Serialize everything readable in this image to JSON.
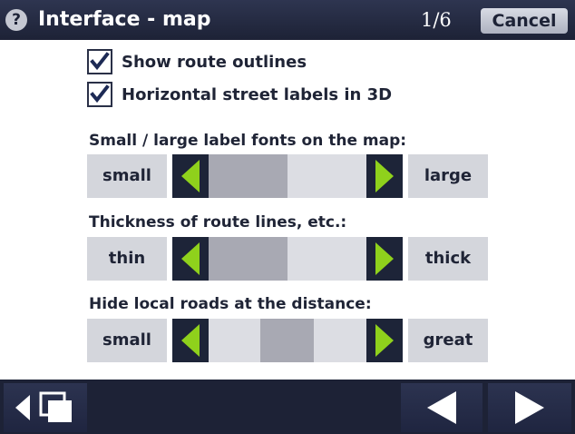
{
  "header": {
    "help_icon": "?",
    "title": "Interface - map",
    "page": "1/6",
    "cancel_label": "Cancel"
  },
  "options": [
    {
      "label": "Show route outlines",
      "checked": true
    },
    {
      "label": "Horizontal street labels in 3D",
      "checked": true
    }
  ],
  "sliders": [
    {
      "label": "Small / large label fonts on the map:",
      "min_label": "small",
      "max_label": "large",
      "segment_start": 0.0,
      "segment_end": 0.5
    },
    {
      "label": "Thickness of route lines, etc.:",
      "min_label": "thin",
      "max_label": "thick",
      "segment_start": 0.0,
      "segment_end": 0.5
    },
    {
      "label": "Hide local roads at the distance:",
      "min_label": "small",
      "max_label": "great",
      "segment_start": 0.33,
      "segment_end": 0.67
    }
  ],
  "colors": {
    "bar": "#1d2236",
    "arrow": "#8fd11c",
    "track": "#dcdde3",
    "fill": "#a8a9b3"
  },
  "icons": {
    "bottom_left": "back-to-menu-icon",
    "prev": "previous-page-icon",
    "next": "next-page-icon"
  }
}
